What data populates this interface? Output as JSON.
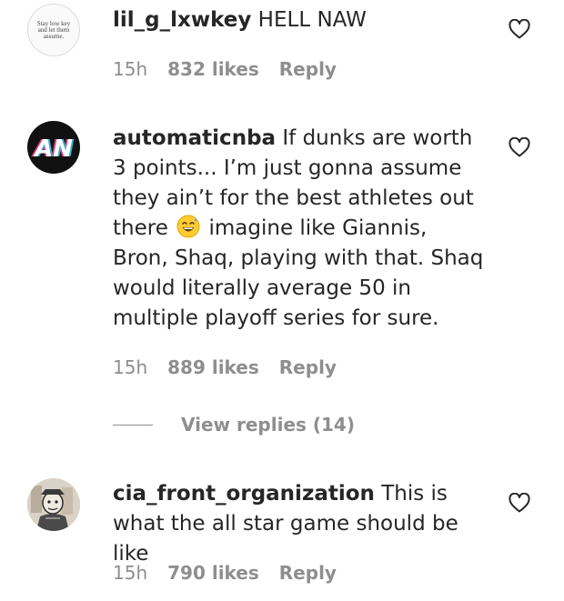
{
  "comments": [
    {
      "avatar_text": "Stay low key and let them assume.",
      "username": "lil_g_lxwkey",
      "text": "HELL NAW",
      "time": "15h",
      "likes": "832 likes",
      "reply": "Reply"
    },
    {
      "avatar_text": "AN",
      "username": "automaticnba",
      "text_before_emoji": "If dunks are worth 3 points... I’m just gonna assume they ain’t for the best athletes out there",
      "emoji": "grinning-sweat-emoji",
      "text_after_emoji": "imagine like Giannis, Bron, Shaq, playing with that. Shaq would literally average 50 in multiple playoff series for sure.",
      "time": "15h",
      "likes": "889 likes",
      "reply": "Reply",
      "view_replies": "View replies (14)"
    },
    {
      "username": "cia_front_organization",
      "text": "This is what the all star game should be like",
      "time": "15h",
      "likes": "790 likes",
      "reply": "Reply"
    }
  ],
  "icons": {
    "like": "heart-outline-icon"
  },
  "colors": {
    "text": "#262626",
    "secondary": "#8e8e8e",
    "background": "#ffffff"
  }
}
